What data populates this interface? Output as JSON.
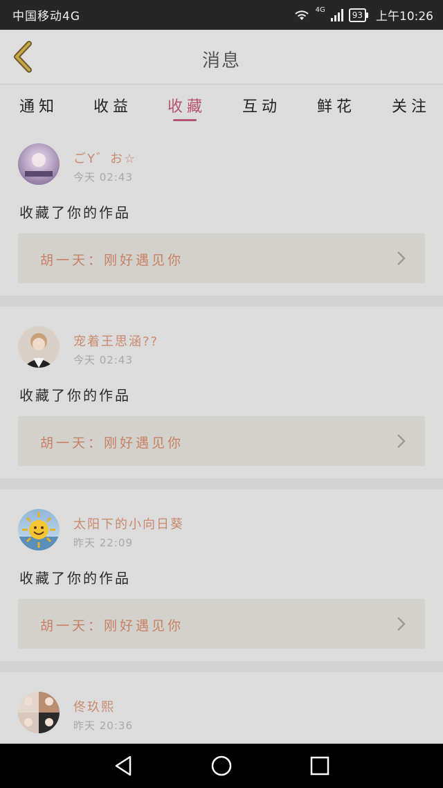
{
  "status_bar": {
    "carrier": "中国移动4G",
    "network": "4G",
    "battery": "93",
    "time": "上午10:26"
  },
  "header": {
    "title": "消息",
    "back_icon": "chevron-left-icon"
  },
  "tabs": [
    {
      "label": "通知",
      "active": false
    },
    {
      "label": "收益",
      "active": false
    },
    {
      "label": "收藏",
      "active": true
    },
    {
      "label": "互动",
      "active": false
    },
    {
      "label": "鲜花",
      "active": false
    },
    {
      "label": "关注",
      "active": false
    }
  ],
  "messages": [
    {
      "username": "ごY゛お☆",
      "time": "今天 02:43",
      "action": "收藏了你的作品",
      "work": "胡一天：刚好遇见你",
      "avatar": "avatar-portrait-purple"
    },
    {
      "username": "宠着王思涵??",
      "time": "今天 02:43",
      "action": "收藏了你的作品",
      "work": "胡一天：刚好遇见你",
      "avatar": "avatar-portrait-boy"
    },
    {
      "username": "太阳下的小向日葵",
      "time": "昨天 22:09",
      "action": "收藏了你的作品",
      "work": "胡一天：刚好遇见你",
      "avatar": "avatar-sun"
    },
    {
      "username": "佟玖熙",
      "time": "昨天 20:36",
      "action": "",
      "work": "",
      "avatar": "avatar-collage"
    }
  ],
  "colors": {
    "accent": "#b3536f",
    "username": "#c98a6d",
    "overlay_dim": "#dcdcdc"
  },
  "nav_bar": {
    "back_icon": "triangle-back-icon",
    "home_icon": "circle-home-icon",
    "recents_icon": "square-recents-icon"
  }
}
